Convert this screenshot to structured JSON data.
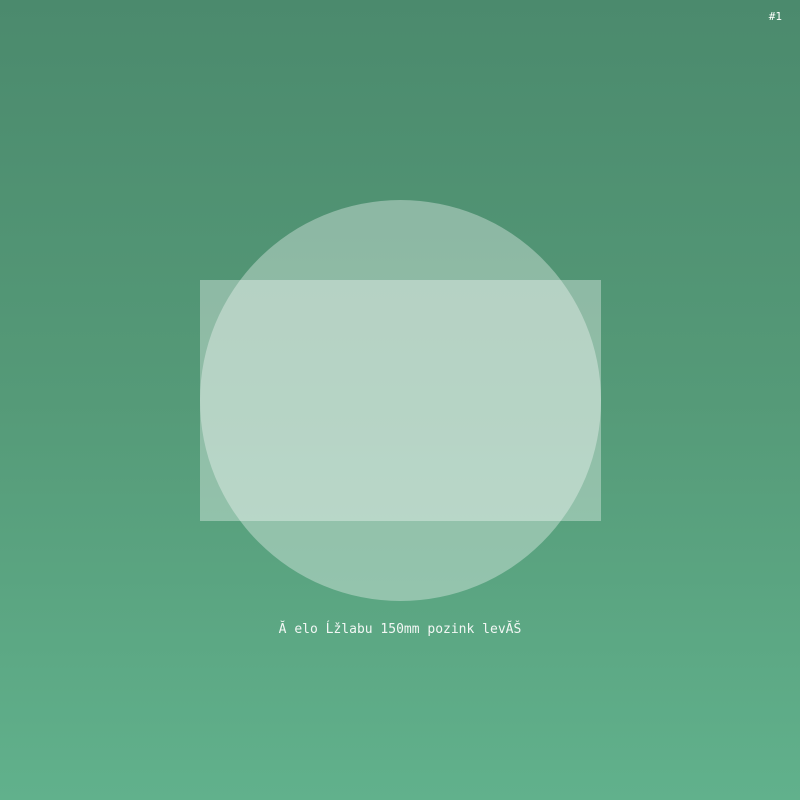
{
  "badge": "#1",
  "caption": "Ă elo Ĺžlabu 150mm pozink levĂŠ",
  "shapes": {
    "circle": "circle",
    "rectangle": "rectangle"
  },
  "colors": {
    "background_top": "#4b8a6d",
    "background_bottom": "#61b18c",
    "shape_fill": "rgba(255,255,255,0.35)",
    "text": "#f2f7f4"
  }
}
